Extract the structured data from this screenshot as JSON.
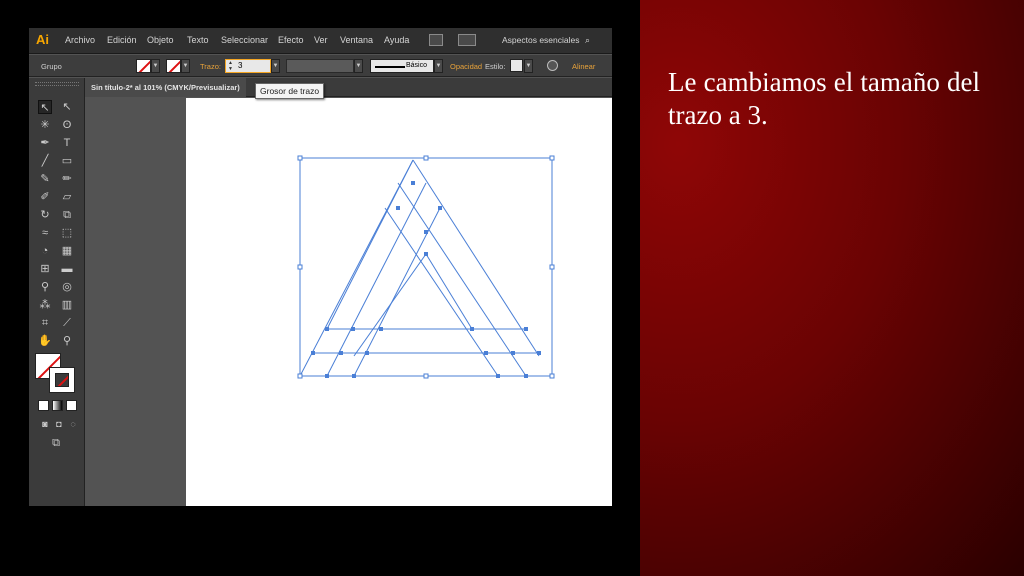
{
  "app": {
    "logo": "Ai",
    "menu": [
      "Archivo",
      "Edición",
      "Objeto",
      "Texto",
      "Seleccionar",
      "Efecto",
      "Ver",
      "Ventana",
      "Ayuda"
    ],
    "workspace_label": "Aspectos esenciales",
    "control": {
      "selection_label": "Grupo",
      "stroke_label": "Trazo:",
      "stroke_value": "3",
      "brush_label": "Básico",
      "opacity_label": "Opacidad",
      "style_label": "Estilo:",
      "align_label": "Alinear"
    },
    "document_tab": "Sin título-2* al 101% (CMYK/Previsualizar)",
    "tooltip": "Grosor de trazo"
  },
  "slide": {
    "line1": "Le cambiamos el",
    "line2": "tamaño del trazo a 3."
  },
  "colors": {
    "slide_bg": "#7a0404",
    "selection": "#4a7fd6",
    "ai_orange": "#f7a600"
  }
}
